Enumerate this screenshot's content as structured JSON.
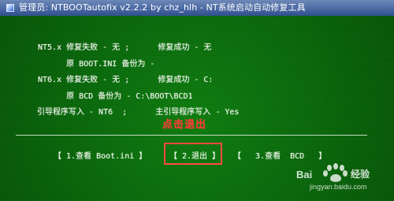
{
  "window": {
    "title": "管理员: NTBOOTautofix v2.2.2 by chz_hlh - NT系统启动自动修复工具"
  },
  "console_lines": [
    "NT5.x 修复失败 - 无 ;      修复成功 - 无",
    "      原 BOOT.INI 备份为 -",
    "NT6.x 修复失败 - 无 ;      修复成功 - C:",
    "      原 BCD 备份为 - C:\\BOOT\\BCD1",
    "引导程序写入 - NT6  ;      主引导程序写入 - Yes"
  ],
  "annotation": {
    "text": "点击退出",
    "color": "#ff3b35"
  },
  "menu": {
    "items": [
      "【 1.查看 Boot.ini 】",
      "【 2.退出 】",
      "【   3.查看  BCD   】"
    ]
  },
  "watermark": {
    "brand": "Bai",
    "brand_suffix": "经验",
    "url": "jingyan.baidu.com"
  },
  "colors": {
    "terminal_background": "#0a6a0c",
    "terminal_text": "#eef5ea",
    "titlebar": "#3f5f98",
    "highlight": "#ff4a3f"
  }
}
